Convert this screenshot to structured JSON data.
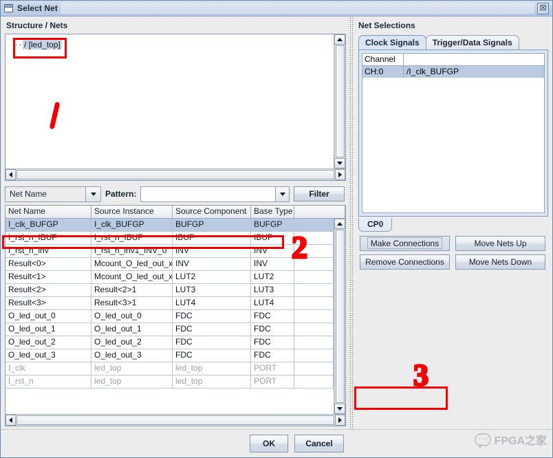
{
  "window": {
    "title": "Select Net",
    "icon": "window-icon",
    "close_label": "☒"
  },
  "left": {
    "structure_title": "Structure / Nets",
    "tree": {
      "root_label": "/ [led_top]"
    },
    "filter": {
      "field_selector": "Net Name",
      "pattern_label": "Pattern:",
      "pattern_value": "",
      "pattern_placeholder": "",
      "filter_button": "Filter"
    },
    "table": {
      "columns": [
        "Net Name",
        "Source Instance",
        "Source Component",
        "Base Type",
        ""
      ],
      "rows": [
        {
          "net": "I_clk_BUFGP",
          "instance": "I_clk_BUFGP",
          "component": "BUFGP",
          "base": "BUFGP",
          "selected": true,
          "dimmed": false
        },
        {
          "net": "I_rst_n_IBUF",
          "instance": "I_rst_n_IBUF",
          "component": "IBUF",
          "base": "IBUF",
          "selected": false,
          "dimmed": false
        },
        {
          "net": "I_rst_n_inv",
          "instance": "I_rst_n_inv1_INV_0",
          "component": "INV",
          "base": "INV",
          "selected": false,
          "dimmed": false
        },
        {
          "net": "Result<0>",
          "instance": "Mcount_O_led_out_xo...",
          "component": "INV",
          "base": "INV",
          "selected": false,
          "dimmed": false
        },
        {
          "net": "Result<1>",
          "instance": "Mcount_O_led_out_xo...",
          "component": "LUT2",
          "base": "LUT2",
          "selected": false,
          "dimmed": false
        },
        {
          "net": "Result<2>",
          "instance": "Result<2>1",
          "component": "LUT3",
          "base": "LUT3",
          "selected": false,
          "dimmed": false
        },
        {
          "net": "Result<3>",
          "instance": "Result<3>1",
          "component": "LUT4",
          "base": "LUT4",
          "selected": false,
          "dimmed": false
        },
        {
          "net": "O_led_out_0",
          "instance": "O_led_out_0",
          "component": "FDC",
          "base": "FDC",
          "selected": false,
          "dimmed": false
        },
        {
          "net": "O_led_out_1",
          "instance": "O_led_out_1",
          "component": "FDC",
          "base": "FDC",
          "selected": false,
          "dimmed": false
        },
        {
          "net": "O_led_out_2",
          "instance": "O_led_out_2",
          "component": "FDC",
          "base": "FDC",
          "selected": false,
          "dimmed": false
        },
        {
          "net": "O_led_out_3",
          "instance": "O_led_out_3",
          "component": "FDC",
          "base": "FDC",
          "selected": false,
          "dimmed": false
        },
        {
          "net": "I_clk",
          "instance": "led_top",
          "component": "led_top",
          "base": "PORT",
          "selected": false,
          "dimmed": true
        },
        {
          "net": "I_rst_n",
          "instance": "led_top",
          "component": "led_top",
          "base": "PORT",
          "selected": false,
          "dimmed": true
        }
      ]
    }
  },
  "right": {
    "title": "Net Selections",
    "tabs": [
      {
        "label": "Clock Signals",
        "active": true
      },
      {
        "label": "Trigger/Data Signals",
        "active": false
      }
    ],
    "net_list": {
      "columns": [
        "Channel",
        ""
      ],
      "rows": [
        {
          "channel": "CH:0",
          "net": "/I_clk_BUFGP"
        }
      ]
    },
    "unit_tab": "CP0",
    "buttons": {
      "make_connections": "Make Connections",
      "move_nets_up": "Move Nets Up",
      "remove_connections": "Remove Connections",
      "move_nets_down": "Move Nets Down"
    }
  },
  "footer": {
    "ok": "OK",
    "cancel": "Cancel",
    "watermark": "FPGA之家"
  },
  "annotations": [
    {
      "id": "1",
      "label": "1"
    },
    {
      "id": "2",
      "label": "2"
    },
    {
      "id": "3",
      "label": "3"
    }
  ],
  "colors": {
    "annotation_red": "#f40000",
    "selection_blue": "#b9cbe2",
    "titlebar_blue": "#b4c7e2",
    "panel_grey": "#ececec"
  }
}
